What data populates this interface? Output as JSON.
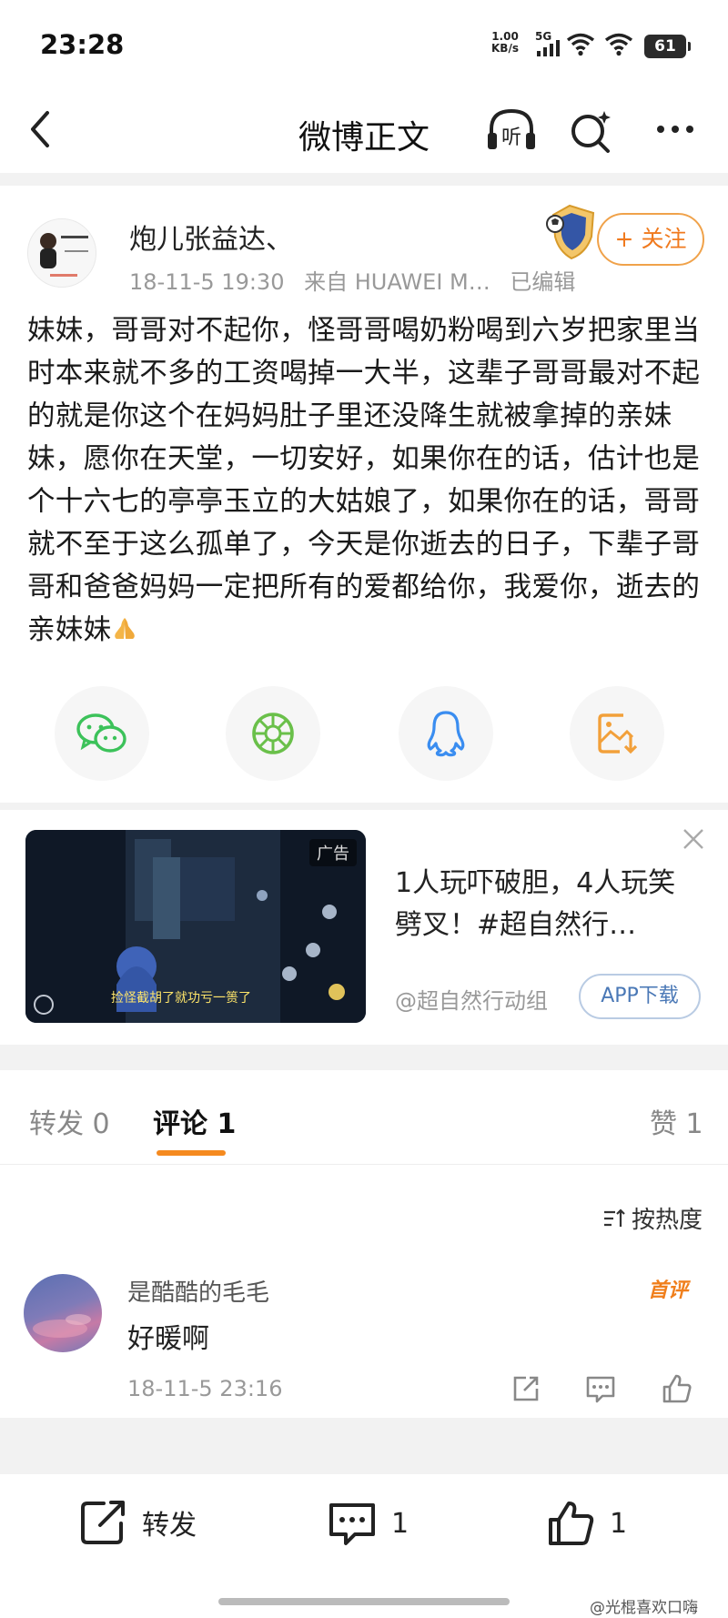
{
  "status_bar": {
    "time": "23:28",
    "net_speed_value": "1.00",
    "net_speed_unit": "KB/s",
    "network": "5G",
    "battery": "61"
  },
  "nav": {
    "title": "微博正文",
    "listen_label": "听"
  },
  "post": {
    "author": "炮儿张益达、",
    "date": "18-11-5 19:30",
    "source": "来自 HUAWEI M…",
    "edited": "已编辑",
    "follow_label": "+ 关注",
    "body": "妹妹，哥哥对不起你，怪哥哥喝奶粉喝到六岁把家里当时本来就不多的工资喝掉一大半，这辈子哥哥最对不起的就是你这个在妈妈肚子里还没降生就被拿掉的亲妹妹，愿你在天堂，一切安好，如果你在的话，估计也是个十六七的亭亭玉立的大姑娘了，如果你在的话，哥哥就不至于这么孤单了，今天是你逝去的日子，下辈子哥哥和爸爸妈妈一定把所有的爱都给你，我爱你，逝去的亲妹妹"
  },
  "share": {
    "icons": [
      "wechat-icon",
      "moments-icon",
      "qq-icon",
      "save-image-icon"
    ]
  },
  "ad": {
    "tag": "广告",
    "image_caption": "捡怪截胡了就功亏一篑了",
    "title": "1人玩吓破胆，4人玩笑劈叉！#超自然行…",
    "source": "@超自然行动组",
    "download_label": "APP下载"
  },
  "tabs": {
    "repost": "转发 0",
    "comments": "评论 1",
    "likes": "赞 1"
  },
  "sort_label": "按热度",
  "comment": {
    "user": "是酷酷的毛毛",
    "first_badge": "首评",
    "text": "好暖啊",
    "time": "18-11-5 23:16"
  },
  "bottom_bar": {
    "repost_label": "转发",
    "comment_count": "1",
    "like_count": "1"
  },
  "watermark": "@光棍喜欢口嗨",
  "colors": {
    "accent": "#f58a1f",
    "follow_text": "#f07a1e",
    "link_blue": "#4a78b6",
    "wechat_green": "#3cc25a",
    "qq_blue": "#3a8df0",
    "save_orange": "#f2a03a"
  }
}
